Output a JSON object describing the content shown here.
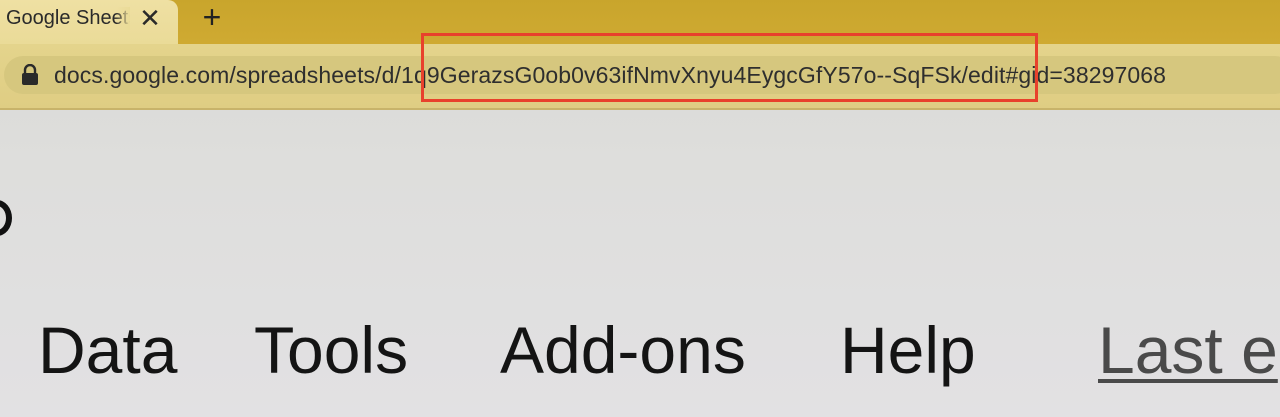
{
  "tab": {
    "title": "Google Sheets",
    "close_symbol": "✕",
    "new_tab_symbol": "+"
  },
  "omnibox": {
    "lock_icon": "lock-icon",
    "url_prefix": "docs.google.com/spreadsheets/d/",
    "url_doc_id": "1q9GerazsG0ob0v63ifNmvXnyu4EygcGfY57o--SqFSk",
    "url_suffix": "/edit#gid=38297068"
  },
  "highlight": {
    "color": "#e8412c",
    "target": "url_doc_id"
  },
  "menubar": {
    "items": [
      {
        "label": "Data"
      },
      {
        "label": "Tools"
      },
      {
        "label": "Add-ons"
      },
      {
        "label": "Help"
      }
    ],
    "last_edit_label": "Last e"
  },
  "colors": {
    "tabstrip": "#cfaa32",
    "active_tab": "#eadb98",
    "toolbar": "#e0cf86",
    "content_bg": "#dfdfdd"
  }
}
